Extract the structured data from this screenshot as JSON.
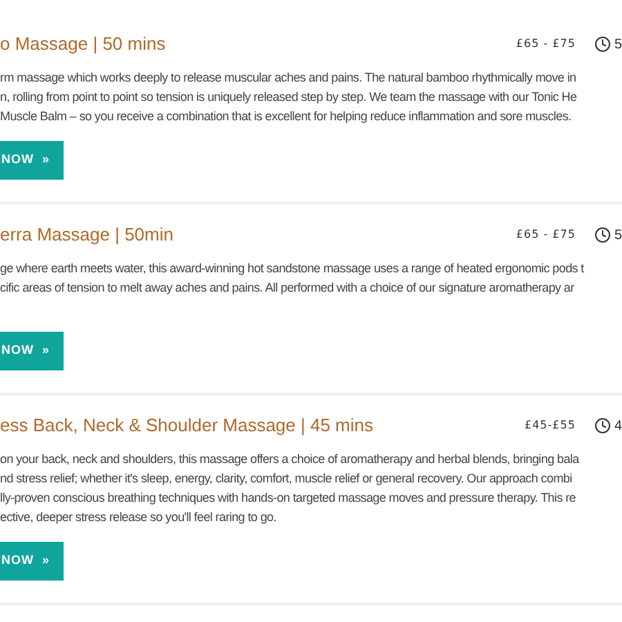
{
  "services": [
    {
      "title": "o Massage | 50 mins",
      "price": "£65 - £75",
      "duration": "5",
      "lines": [
        "rm massage which works deeply to release muscular aches and pains.  The natural bamboo rhythmically move in",
        "n, rolling from point to point so tension is uniquely released step by step. We team the massage with our Tonic He",
        "Muscle Balm – so you receive a combination that is excellent for helping reduce inflammation and sore muscles."
      ],
      "button": {
        "label": "NOW",
        "chevron": "»"
      }
    },
    {
      "title": "erra Massage | 50min",
      "price": "£65 - £75",
      "duration": "5",
      "lines": [
        "ge where earth meets water, this award-winning hot sandstone massage uses a range of heated ergonomic pods t",
        "cific areas of tension to melt away aches and pains. All performed with a choice of our signature aromatherapy ar"
      ],
      "button": {
        "label": "NOW",
        "chevron": "»"
      }
    },
    {
      "title": "ess Back, Neck & Shoulder Massage | 45 mins",
      "price": "£45-£55",
      "duration": "4",
      "lines": [
        "on your back, neck and shoulders, this massage offers a choice of aromatherapy and herbal blends, bringing bala",
        "nd stress relief; whether it's sleep, energy, clarity, comfort, muscle relief or general recovery. Our approach combi",
        "lly-proven conscious breathing techniques with hands-on targeted massage moves and pressure therapy. This re",
        "ective, deeper stress release so you'll feel raring to go."
      ],
      "button": {
        "label": "NOW",
        "chevron": "»"
      }
    }
  ]
}
